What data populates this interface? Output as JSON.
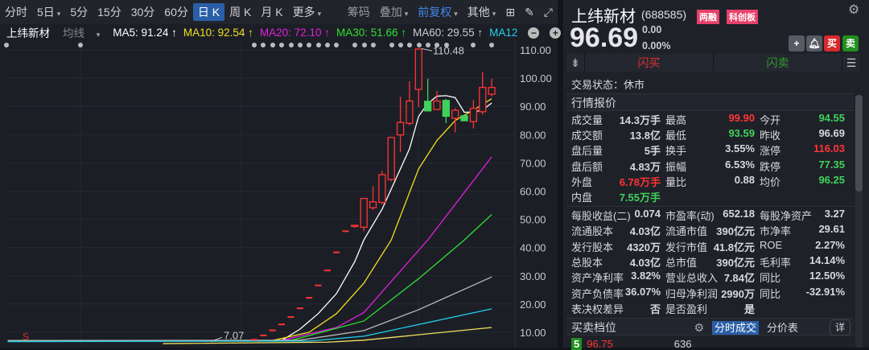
{
  "toolbar": {
    "periods": [
      "分时",
      "5日",
      "5分",
      "15分",
      "30分",
      "60分",
      "日 K",
      "周 K",
      "月 K",
      "更多"
    ],
    "active": "日 K",
    "right": [
      "筹码",
      "叠加",
      "前复权",
      "其他"
    ]
  },
  "ma_bar": {
    "stock": "上纬新材",
    "type": "均线",
    "ma5": "MA5: 91.24 ↑",
    "ma10": "MA10: 92.54 ↑",
    "ma20": "MA20: 72.10 ↑",
    "ma30": "MA30: 51.66 ↑",
    "ma60": "MA60: 29.55 ↑",
    "ma120": "MA12"
  },
  "colors": {
    "up": "#ff3434",
    "down": "#3fd25a",
    "ma5": "#ffffff",
    "ma10": "#f0e020",
    "ma20": "#e020e0",
    "ma30": "#30e030",
    "ma60": "#bbbbbb",
    "ma120": "#20d0e8",
    "ma250": "#f0e060"
  },
  "chart_data": {
    "type": "candlestick",
    "y_ticks": [
      "110.00",
      "100.00",
      "90.00",
      "80.00",
      "70.00",
      "60.00",
      "50.00",
      "40.00",
      "30.00",
      "20.00",
      "10.00"
    ],
    "ylim": [
      5,
      113
    ],
    "high_label": "110.48",
    "low_label": "7.07",
    "marker": "S",
    "limit_up_days": [
      7.4,
      8.9,
      10.7,
      12.8,
      15.4,
      18.5,
      22.2,
      26.6,
      31.9,
      38.3,
      45.8
    ],
    "candles": [
      [
        47.9,
        48.0,
        47.0,
        47.9
      ],
      [
        47.2,
        57.4,
        45.8,
        57.4
      ],
      [
        54.1,
        61.7,
        53.3,
        56.2
      ],
      [
        56,
        67.1,
        55.3,
        65.8
      ],
      [
        64.1,
        79,
        63.5,
        79
      ],
      [
        79.9,
        93.4,
        73.8,
        84.3
      ],
      [
        84,
        98.9,
        83.3,
        91.9
      ],
      [
        96,
        110.48,
        89.8,
        110.3
      ],
      [
        91.8,
        99.8,
        88.4,
        88.4
      ],
      [
        88.9,
        95.5,
        88.9,
        91.9
      ],
      [
        92.1,
        92.6,
        84.1,
        86.5
      ],
      [
        85.8,
        89.4,
        80.8,
        88.6
      ],
      [
        86.7,
        86.7,
        84.9,
        84.9
      ],
      [
        84.6,
        92.2,
        82.2,
        89.3
      ],
      [
        88.1,
        102.2,
        87.1,
        96.7
      ],
      [
        94.3,
        99.8,
        93.6,
        96.7
      ]
    ],
    "ma": {
      "ma5": [
        [
          -27,
          7.07
        ],
        [
          3,
          7.1
        ],
        [
          5,
          11.1
        ],
        [
          7,
          16.6
        ],
        [
          9,
          23.7
        ],
        [
          11,
          35
        ],
        [
          12,
          42.7
        ],
        [
          14,
          53.6
        ],
        [
          17,
          75
        ],
        [
          18,
          86.5
        ],
        [
          19,
          91
        ],
        [
          20,
          93.6
        ],
        [
          21,
          93.8
        ],
        [
          22,
          93.1
        ],
        [
          23,
          87.9
        ],
        [
          24,
          88
        ],
        [
          25,
          88.7
        ],
        [
          26,
          91.2
        ]
      ],
      "ma10": [
        [
          -27,
          7.07
        ],
        [
          2,
          7.1
        ],
        [
          6,
          10
        ],
        [
          9,
          16.6
        ],
        [
          12,
          27.4
        ],
        [
          15,
          42.7
        ],
        [
          18,
          67.9
        ],
        [
          20,
          77.9
        ],
        [
          22,
          85
        ],
        [
          24,
          88.7
        ],
        [
          26,
          92.7
        ]
      ],
      "ma20": [
        [
          -27,
          7.07
        ],
        [
          3,
          7.1
        ],
        [
          9,
          11.7
        ],
        [
          12,
          17
        ],
        [
          19,
          42.7
        ],
        [
          26,
          72.1
        ]
      ],
      "ma30": [
        [
          -27,
          7.07
        ],
        [
          4,
          7.1
        ],
        [
          12,
          14
        ],
        [
          18,
          29
        ],
        [
          23,
          42.7
        ],
        [
          26,
          51.7
        ]
      ],
      "ma60": [
        [
          -27,
          7.07
        ],
        [
          5,
          7.2
        ],
        [
          12,
          10.6
        ],
        [
          18,
          18
        ],
        [
          26,
          29.6
        ]
      ],
      "ma120": [
        [
          -27,
          6.7
        ],
        [
          6,
          6.9
        ],
        [
          12,
          8.6
        ],
        [
          26,
          18.3
        ]
      ],
      "ma250": [
        [
          -10,
          6
        ],
        [
          8,
          6.5
        ],
        [
          12,
          7.2
        ],
        [
          26,
          11.7
        ]
      ]
    }
  },
  "quote": {
    "name": "上纬新材",
    "code": "(688585)",
    "tags": [
      "两融",
      "科创板"
    ],
    "price": "96.69",
    "change": "0.00",
    "pct": "0.00%",
    "buy": "买",
    "sell": "卖",
    "flash_buy": "闪买",
    "flash_sell": "闪卖",
    "status": "交易状态：休市",
    "section": "行情报价",
    "rows": [
      [
        [
          "成交量",
          "14.3万手",
          ""
        ],
        [
          "最高",
          "99.90",
          "red"
        ],
        [
          "今开",
          "94.55",
          "grn"
        ]
      ],
      [
        [
          "成交额",
          "13.8亿",
          ""
        ],
        [
          "最低",
          "93.59",
          "grn"
        ],
        [
          "昨收",
          "96.69",
          ""
        ]
      ],
      [
        [
          "盘后量",
          "5手",
          ""
        ],
        [
          "换手",
          "3.55%",
          ""
        ],
        [
          "涨停",
          "116.03",
          "red"
        ]
      ],
      [
        [
          "盘后额",
          "4.83万",
          ""
        ],
        [
          "振幅",
          "6.53%",
          ""
        ],
        [
          "跌停",
          "77.35",
          "grn"
        ]
      ],
      [
        [
          "外盘",
          "6.78万手",
          "red"
        ],
        [
          "量比",
          "0.88",
          ""
        ],
        [
          "均价",
          "96.25",
          "grn"
        ]
      ],
      [
        [
          "内盘",
          "7.55万手",
          "grn"
        ],
        [
          "",
          ""
        ],
        [
          "",
          ""
        ]
      ]
    ],
    "fin": [
      [
        [
          "每股收益(二)",
          "0.074"
        ],
        [
          "市盈率(动)",
          "652.18"
        ],
        [
          "每股净资产",
          "3.27"
        ]
      ],
      [
        [
          "流通股本",
          "4.03亿"
        ],
        [
          "流通市值",
          "390亿元"
        ],
        [
          "市净率",
          "29.61"
        ]
      ],
      [
        [
          "发行股本",
          "4320万"
        ],
        [
          "发行市值",
          "41.8亿元"
        ],
        [
          "ROE",
          "2.27%"
        ]
      ],
      [
        [
          "总股本",
          "4.03亿"
        ],
        [
          "总市值",
          "390亿元"
        ],
        [
          "毛利率",
          "14.14%"
        ]
      ],
      [
        [
          "资产净利率",
          "3.82%"
        ],
        [
          "营业总收入",
          "7.84亿"
        ],
        [
          "同比",
          "12.50%"
        ]
      ],
      [
        [
          "资产负债率",
          "36.07%"
        ],
        [
          "归母净利润",
          "2990万"
        ],
        [
          "同比",
          "-32.91%"
        ]
      ],
      [
        [
          "表决权差异",
          "否"
        ],
        [
          "是否盈利",
          "是"
        ],
        [
          "",
          ""
        ]
      ]
    ],
    "orderbook": {
      "title": "买卖档位",
      "tab1": "分时成交",
      "tab2": "分价表",
      "detail": "详",
      "level": "5",
      "price": "96.75",
      "vol": "636"
    }
  }
}
